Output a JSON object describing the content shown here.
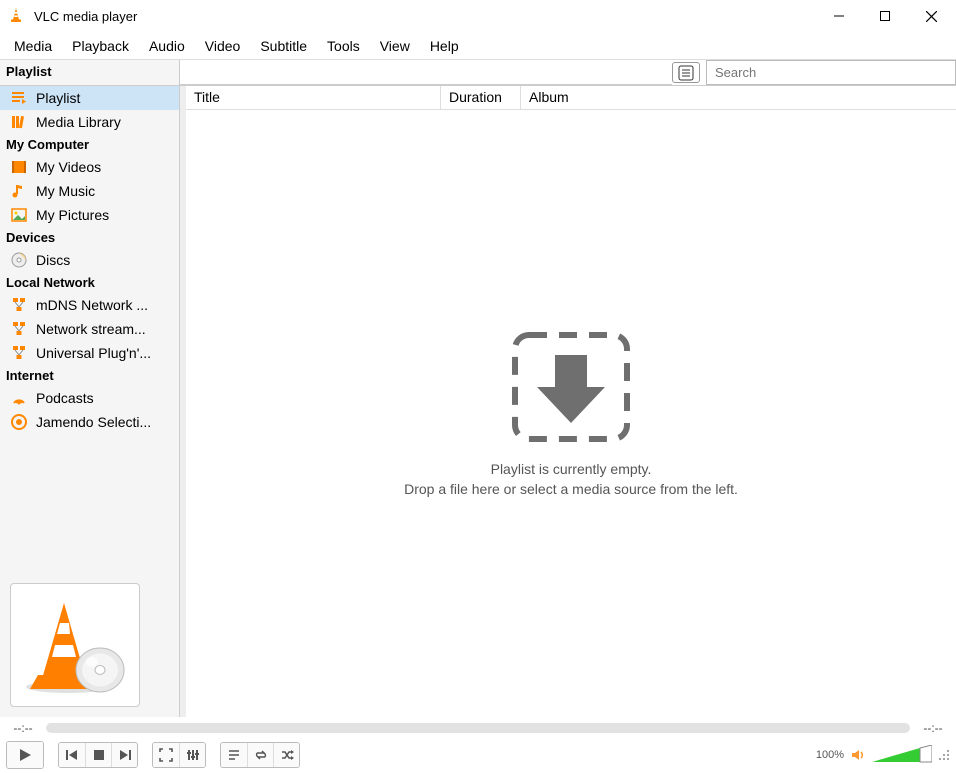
{
  "titlebar": {
    "title": "VLC media player"
  },
  "menubar": [
    "Media",
    "Playback",
    "Audio",
    "Video",
    "Subtitle",
    "Tools",
    "View",
    "Help"
  ],
  "sidebar_header": "Playlist",
  "search": {
    "placeholder": "Search"
  },
  "sidebar": [
    {
      "type": "item",
      "label": "Playlist",
      "icon": "playlist",
      "selected": true
    },
    {
      "type": "item",
      "label": "Media Library",
      "icon": "library"
    },
    {
      "type": "head",
      "label": "My Computer"
    },
    {
      "type": "item",
      "label": "My Videos",
      "icon": "video"
    },
    {
      "type": "item",
      "label": "My Music",
      "icon": "music"
    },
    {
      "type": "item",
      "label": "My Pictures",
      "icon": "picture"
    },
    {
      "type": "head",
      "label": "Devices"
    },
    {
      "type": "item",
      "label": "Discs",
      "icon": "disc"
    },
    {
      "type": "head",
      "label": "Local Network"
    },
    {
      "type": "item",
      "label": "mDNS Network ...",
      "icon": "network"
    },
    {
      "type": "item",
      "label": "Network stream...",
      "icon": "network"
    },
    {
      "type": "item",
      "label": "Universal Plug'n'...",
      "icon": "network"
    },
    {
      "type": "head",
      "label": "Internet"
    },
    {
      "type": "item",
      "label": "Podcasts",
      "icon": "podcast"
    },
    {
      "type": "item",
      "label": "Jamendo Selecti...",
      "icon": "jamendo"
    }
  ],
  "columns": {
    "title": "Title",
    "duration": "Duration",
    "album": "Album"
  },
  "empty": {
    "line1": "Playlist is currently empty.",
    "line2": "Drop a file here or select a media source from the left."
  },
  "time": {
    "elapsed": "--:--",
    "total": "--:--"
  },
  "volume": {
    "label": "100%"
  }
}
